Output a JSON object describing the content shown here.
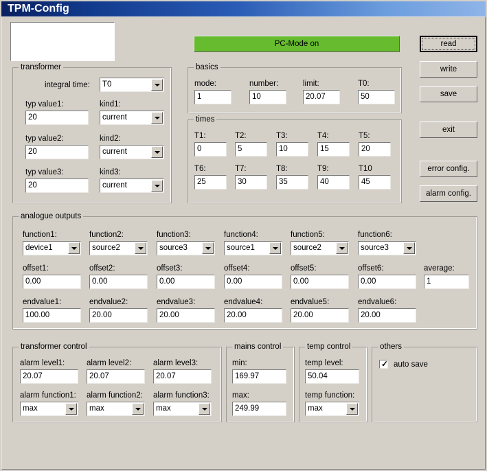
{
  "window": {
    "title": "TPM-Config"
  },
  "status": {
    "pc_mode_label": "PC-Mode on",
    "pc_mode_color": "#66bb2e"
  },
  "buttons": {
    "read": "read",
    "write": "write",
    "save": "save",
    "exit": "exit",
    "error_config": "error config.",
    "alarm_config": "alarm config."
  },
  "transformer": {
    "title": "transformer",
    "integral_time_label": "integral time:",
    "integral_time_value": "T0",
    "rows": [
      {
        "value_label": "typ value1:",
        "value": "20",
        "kind_label": "kind1:",
        "kind": "current"
      },
      {
        "value_label": "typ value2:",
        "value": "20",
        "kind_label": "kind2:",
        "kind": "current"
      },
      {
        "value_label": "typ value3:",
        "value": "20",
        "kind_label": "kind3:",
        "kind": "current"
      }
    ]
  },
  "basics": {
    "title": "basics",
    "fields": [
      {
        "label": "mode:",
        "value": "1"
      },
      {
        "label": "number:",
        "value": "10"
      },
      {
        "label": "limit:",
        "value": "20.07"
      },
      {
        "label": "T0:",
        "value": "50"
      }
    ]
  },
  "times": {
    "title": "times",
    "fields": [
      {
        "label": "T1:",
        "value": "0"
      },
      {
        "label": "T2:",
        "value": "5"
      },
      {
        "label": "T3:",
        "value": "10"
      },
      {
        "label": "T4:",
        "value": "15"
      },
      {
        "label": "T5:",
        "value": "20"
      },
      {
        "label": "T6:",
        "value": "25"
      },
      {
        "label": "T7:",
        "value": "30"
      },
      {
        "label": "T8:",
        "value": "35"
      },
      {
        "label": "T9:",
        "value": "40"
      },
      {
        "label": "T10",
        "value": "45"
      }
    ]
  },
  "analogue_outputs": {
    "title": "analogue outputs",
    "channels": [
      {
        "function_label": "function1:",
        "function": "device1",
        "offset_label": "offset1:",
        "offset": "0.00",
        "endvalue_label": "endvalue1:",
        "endvalue": "100.00"
      },
      {
        "function_label": "function2:",
        "function": "source2",
        "offset_label": "offset2:",
        "offset": "0.00",
        "endvalue_label": "endvalue2:",
        "endvalue": "20.00"
      },
      {
        "function_label": "function3:",
        "function": "source3",
        "offset_label": "offset3:",
        "offset": "0.00",
        "endvalue_label": "endvalue3:",
        "endvalue": "20.00"
      },
      {
        "function_label": "function4:",
        "function": "source1",
        "offset_label": "offset4:",
        "offset": "0.00",
        "endvalue_label": "endvalue4:",
        "endvalue": "20.00"
      },
      {
        "function_label": "function5:",
        "function": "source2",
        "offset_label": "offset5:",
        "offset": "0.00",
        "endvalue_label": "endvalue5:",
        "endvalue": "20.00"
      },
      {
        "function_label": "function6:",
        "function": "source3",
        "offset_label": "offset6:",
        "offset": "0.00",
        "endvalue_label": "endvalue6:",
        "endvalue": "20.00"
      }
    ],
    "average_label": "average:",
    "average_value": "1"
  },
  "transformer_control": {
    "title": "transformer control",
    "channels": [
      {
        "level_label": "alarm level1:",
        "level": "20.07",
        "function_label": "alarm function1:",
        "function": "max"
      },
      {
        "level_label": "alarm level2:",
        "level": "20.07",
        "function_label": "alarm function2:",
        "function": "max"
      },
      {
        "level_label": "alarm level3:",
        "level": "20.07",
        "function_label": "alarm function3:",
        "function": "max"
      }
    ]
  },
  "mains_control": {
    "title": "mains control",
    "min_label": "min:",
    "min_value": "169.97",
    "max_label": "max:",
    "max_value": "249.99"
  },
  "temp_control": {
    "title": "temp control",
    "level_label": "temp level:",
    "level_value": "50.04",
    "function_label": "temp function:",
    "function_value": "max"
  },
  "others": {
    "title": "others",
    "auto_save_label": "auto save",
    "auto_save_checked": true
  }
}
